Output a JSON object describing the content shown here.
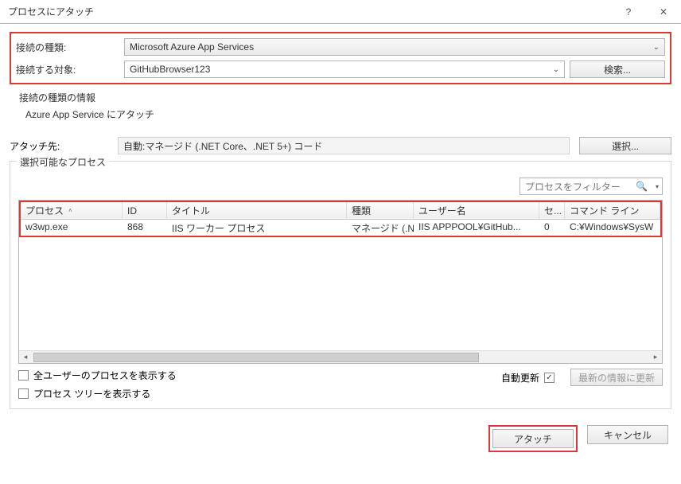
{
  "title": "プロセスにアタッチ",
  "labels": {
    "connType": "接続の種類:",
    "connTarget": "接続する対象:",
    "attachTo": "アタッチ先:"
  },
  "connType": {
    "value": "Microsoft Azure App Services"
  },
  "connTarget": {
    "value": "GitHubBrowser123",
    "searchBtn": "検索..."
  },
  "info": {
    "title": "接続の種類の情報",
    "text": "Azure App Service にアタッチ"
  },
  "attachTo": {
    "value": "自動:マネージド (.NET Core、.NET 5+) コード",
    "selectBtn": "選択..."
  },
  "group": {
    "legend": "選択可能なプロセス",
    "filterPlaceholder": "プロセスをフィルター"
  },
  "columns": {
    "process": "プロセス",
    "id": "ID",
    "title": "タイトル",
    "type": "種類",
    "user": "ユーザー名",
    "session": "セ...",
    "cmd": "コマンド ライン"
  },
  "rows": [
    {
      "process": "w3wp.exe",
      "id": "868",
      "title": "IIS ワーカー プロセス",
      "type": "マネージド (.N...",
      "user": "IIS APPPOOL¥GitHub...",
      "session": "0",
      "cmd": "C:¥Windows¥SysW"
    }
  ],
  "checks": {
    "allUsers": "全ユーザーのプロセスを表示する",
    "procTree": "プロセス ツリーを表示する",
    "autoUpdate": "自動更新"
  },
  "buttons": {
    "refresh": "最新の情報に更新",
    "attach": "アタッチ",
    "cancel": "キャンセル"
  }
}
